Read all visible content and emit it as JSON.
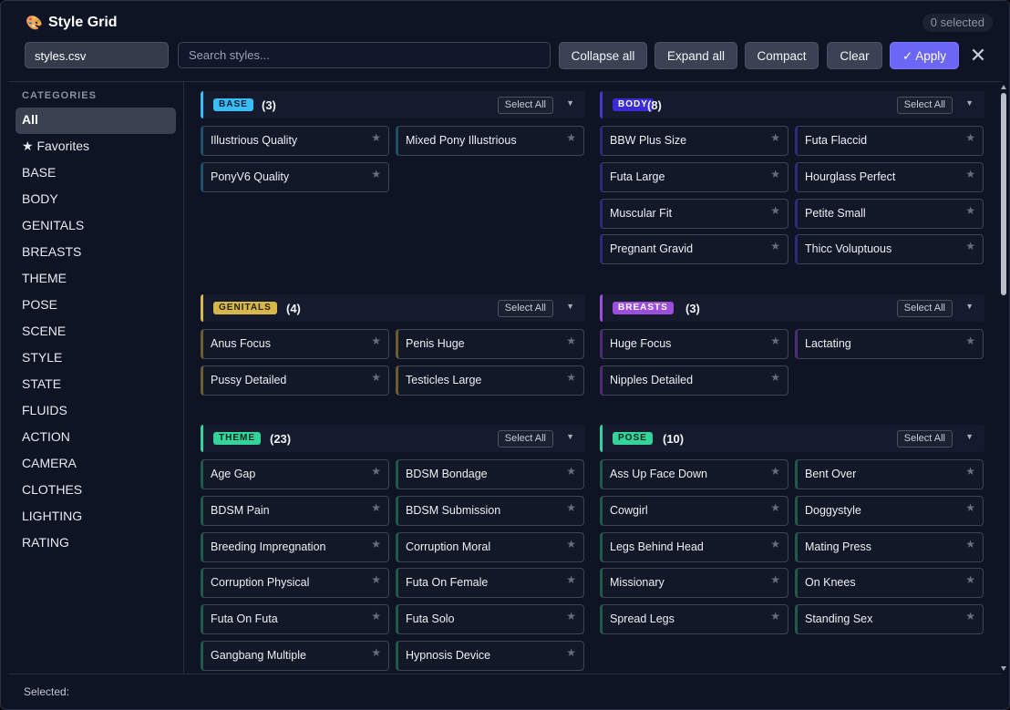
{
  "window": {
    "title_icon": "🎨",
    "title": "Style Grid",
    "selected_count": "0 selected"
  },
  "toolbar": {
    "file": "styles.csv",
    "search_placeholder": "Search styles...",
    "collapse_label": "Collapse all",
    "expand_label": "Expand all",
    "compact_label": "Compact",
    "clear_label": "Clear",
    "apply_label": "✓ Apply",
    "close_icon": "close-icon"
  },
  "sidebar": {
    "heading": "CATEGORIES",
    "items": [
      {
        "label": "All",
        "active": true
      },
      {
        "label": "★ Favorites"
      },
      {
        "label": "BASE"
      },
      {
        "label": "BODY"
      },
      {
        "label": "GENITALS"
      },
      {
        "label": "BREASTS"
      },
      {
        "label": "THEME"
      },
      {
        "label": "POSE"
      },
      {
        "label": "SCENE"
      },
      {
        "label": "STYLE"
      },
      {
        "label": "STATE"
      },
      {
        "label": "FLUIDS"
      },
      {
        "label": "ACTION"
      },
      {
        "label": "CAMERA"
      },
      {
        "label": "CLOTHES"
      },
      {
        "label": "LIGHTING"
      },
      {
        "label": "RATING"
      }
    ]
  },
  "select_all_label": "Select All",
  "star_glyph": "★",
  "caret_glyph": "▼",
  "sections": [
    {
      "tag": "BASE",
      "count": "(3)",
      "tag_bg": "#38bdf8",
      "tag_fg": "#0b1a2a",
      "accent": "#38bdf8",
      "card_accent": "#1f4f6a",
      "items": [
        "Illustrious Quality",
        "Mixed Pony Illustrious",
        "PonyV6 Quality"
      ]
    },
    {
      "tag": "BODY",
      "count": "(8)",
      "tag_bg": "#3b2bd6",
      "tag_fg": "#ffffff",
      "accent": "#4338ca",
      "card_accent": "#2e2a7a",
      "items": [
        "BBW Plus Size",
        "Futa Flaccid",
        "Futa Large",
        "Hourglass Perfect",
        "Muscular Fit",
        "Petite Small",
        "Pregnant Gravid",
        "Thicc Voluptuous"
      ]
    },
    {
      "tag": "GENITALS",
      "count": "(4)",
      "tag_bg": "#d6b84a",
      "tag_fg": "#2a2206",
      "accent": "#d6b84a",
      "card_accent": "#6b5d2e",
      "items": [
        "Anus Focus",
        "Penis Huge",
        "Pussy Detailed",
        "Testicles Large"
      ]
    },
    {
      "tag": "BREASTS",
      "count": "(3)",
      "tag_bg": "#9d4edd",
      "tag_fg": "#ffffff",
      "accent": "#9d4edd",
      "card_accent": "#4e2c70",
      "items": [
        "Huge Focus",
        "Lactating",
        "Nipples Detailed"
      ]
    },
    {
      "tag": "THEME",
      "count": "(23)",
      "tag_bg": "#34d399",
      "tag_fg": "#062a1d",
      "accent": "#34d399",
      "card_accent": "#1e5a48",
      "items": [
        "Age Gap",
        "BDSM Bondage",
        "BDSM Pain",
        "BDSM Submission",
        "Breeding Impregnation",
        "Corruption Moral",
        "Corruption Physical",
        "Futa On Female",
        "Futa On Futa",
        "Futa Solo",
        "Gangbang Multiple",
        "Hypnosis Device"
      ]
    },
    {
      "tag": "POSE",
      "count": "(10)",
      "tag_bg": "#34d399",
      "tag_fg": "#062a1d",
      "accent": "#34d399",
      "card_accent": "#1e5a48",
      "items": [
        "Ass Up Face Down",
        "Bent Over",
        "Cowgirl",
        "Doggystyle",
        "Legs Behind Head",
        "Mating Press",
        "Missionary",
        "On Knees",
        "Spread Legs",
        "Standing Sex"
      ]
    }
  ],
  "footer": {
    "selected_label": "Selected:"
  }
}
